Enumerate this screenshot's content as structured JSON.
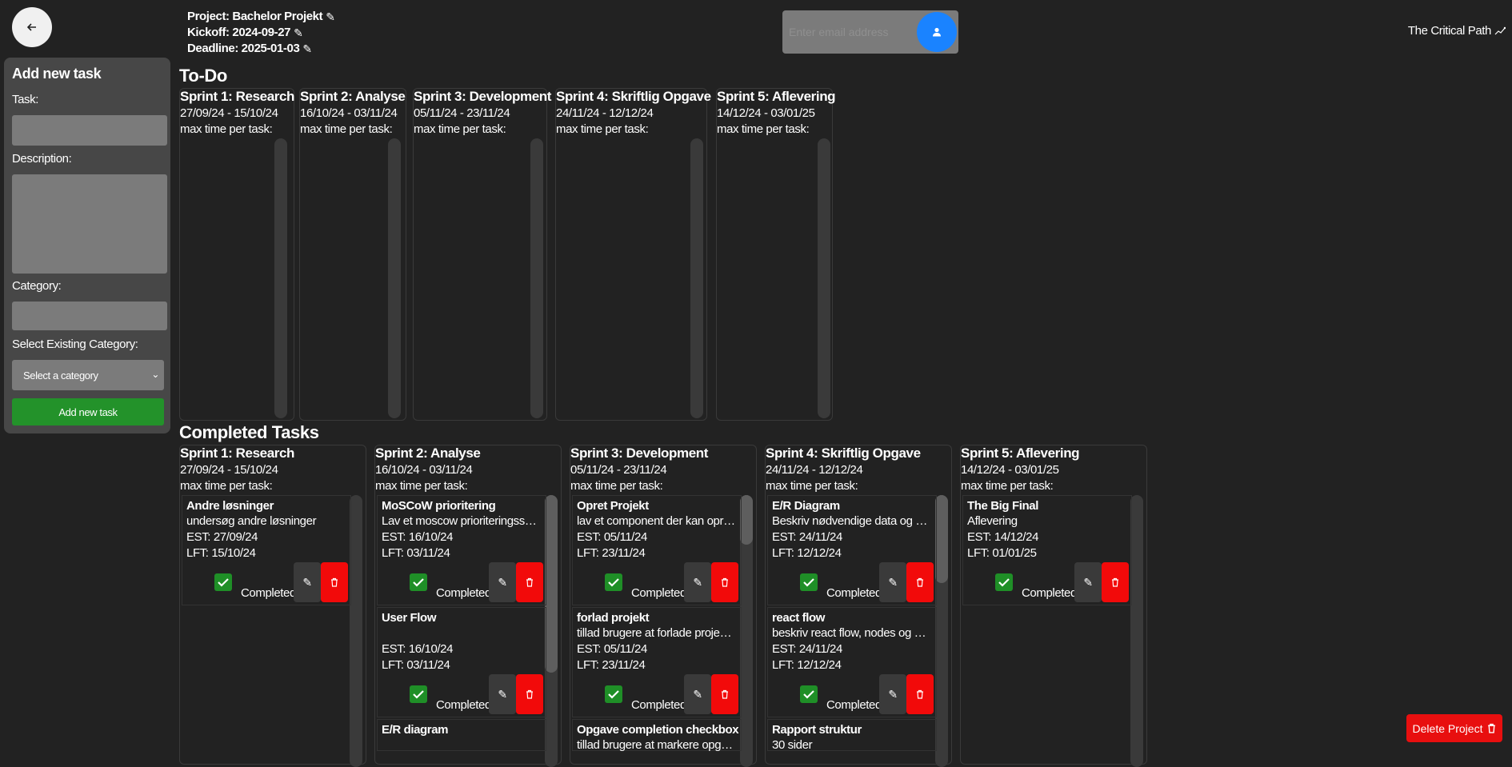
{
  "back_button": {
    "icon": "arrow-left-icon"
  },
  "project": {
    "project_label": "Project: Bachelor Projekt",
    "kickoff_label": "Kickoff: 2024-09-27",
    "deadline_label": "Deadline: 2025-01-03"
  },
  "invite": {
    "placeholder": "Enter email address",
    "icon": "user-add-icon"
  },
  "critical_path": {
    "label": "The Critical Path"
  },
  "sidebar": {
    "title": "Add new task",
    "task_label": "Task:",
    "description_label": "Description:",
    "category_label": "Category:",
    "existing_label": "Select Existing Category:",
    "select_value": "Select a category",
    "add_button": "Add new task"
  },
  "todo": {
    "title": "To-Do",
    "sprints": [
      {
        "title": "Sprint 1: Research",
        "dates": "27/09/24 - 15/10/24",
        "max": "max time per task:"
      },
      {
        "title": "Sprint 2: Analyse",
        "dates": "16/10/24 - 03/11/24",
        "max": "max time per task:"
      },
      {
        "title": "Sprint 3: Development",
        "dates": "05/11/24 - 23/11/24",
        "max": "max time per task:"
      },
      {
        "title": "Sprint 4: Skriftlig Opgave",
        "dates": "24/11/24 - 12/12/24",
        "max": "max time per task:"
      },
      {
        "title": "Sprint 5: Aflevering",
        "dates": "14/12/24 - 03/01/25",
        "max": "max time per task:"
      }
    ]
  },
  "completed": {
    "title": "Completed Tasks",
    "sprints": [
      {
        "title": "Sprint 1: Research",
        "dates": "27/09/24 - 15/10/24",
        "max": "max time per task:",
        "tasks": [
          {
            "title": "Andre løsninger",
            "desc": "undersøg andre løsninger",
            "est": "EST: 27/09/24",
            "lft": "LFT: 15/10/24",
            "status": "Completed"
          }
        ]
      },
      {
        "title": "Sprint 2: Analyse",
        "dates": "16/10/24 - 03/11/24",
        "max": "max time per task:",
        "tasks": [
          {
            "title": "MoSCoW prioritering",
            "desc": "Lav et moscow prioriteringsskema",
            "est": "EST: 16/10/24",
            "lft": "LFT: 03/11/24",
            "status": "Completed"
          },
          {
            "title": "User Flow",
            "desc": "",
            "est": "EST: 16/10/24",
            "lft": "LFT: 03/11/24",
            "status": "Completed"
          },
          {
            "title": "E/R diagram",
            "desc": "",
            "est": "",
            "lft": "",
            "status": ""
          }
        ]
      },
      {
        "title": "Sprint 3: Development",
        "dates": "05/11/24 - 23/11/24",
        "max": "max time per task:",
        "tasks": [
          {
            "title": "Opret Projekt",
            "desc": "lav et component der kan oprette projekter",
            "est": "EST: 05/11/24",
            "lft": "LFT: 23/11/24",
            "status": "Completed"
          },
          {
            "title": "forlad projekt",
            "desc": "tillad brugere at forlade projekter",
            "est": "EST: 05/11/24",
            "lft": "LFT: 23/11/24",
            "status": "Completed"
          },
          {
            "title": "Opgave completion checkbox",
            "desc": "tillad brugere at markere opgaver",
            "est": "",
            "lft": "",
            "status": ""
          }
        ]
      },
      {
        "title": "Sprint 4: Skriftlig Opgave",
        "dates": "24/11/24 - 12/12/24",
        "max": "max time per task:",
        "tasks": [
          {
            "title": "E/R Diagram",
            "desc": "Beskriv nødvendige data og strukturer",
            "est": "EST: 24/11/24",
            "lft": "LFT: 12/12/24",
            "status": "Completed"
          },
          {
            "title": "react flow",
            "desc": "beskriv react flow, nodes og edges",
            "est": "EST: 24/11/24",
            "lft": "LFT: 12/12/24",
            "status": "Completed"
          },
          {
            "title": "Rapport struktur",
            "desc": "30 sider",
            "est": "",
            "lft": "",
            "status": ""
          }
        ]
      },
      {
        "title": "Sprint 5: Aflevering",
        "dates": "14/12/24 - 03/01/25",
        "max": "max time per task:",
        "tasks": [
          {
            "title": "The Big Final",
            "desc": "Aflevering",
            "est": "EST: 14/12/24",
            "lft": "LFT: 01/01/25",
            "status": "Completed"
          }
        ]
      }
    ]
  },
  "delete_project": {
    "label": "Delete Project"
  },
  "colors": {
    "background": "#222222",
    "accent_blue": "#1a83ff",
    "success_green": "#23922a",
    "danger_red": "#f20a0a"
  }
}
